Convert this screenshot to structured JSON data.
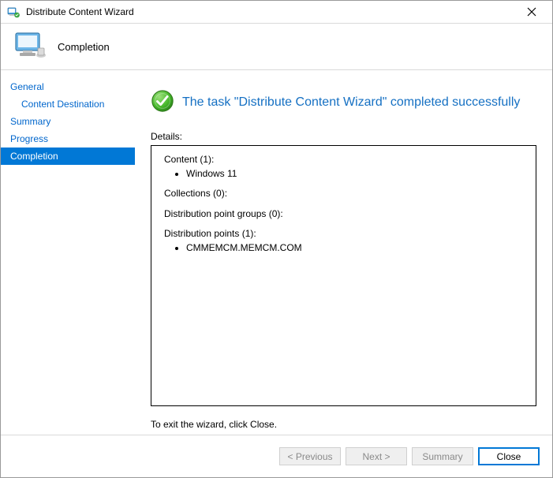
{
  "window": {
    "title": "Distribute Content Wizard"
  },
  "header": {
    "title": "Completion"
  },
  "sidebar": {
    "items": [
      {
        "label": "General"
      },
      {
        "label": "Content Destination"
      },
      {
        "label": "Summary"
      },
      {
        "label": "Progress"
      },
      {
        "label": "Completion"
      }
    ]
  },
  "main": {
    "successMessage": "The task \"Distribute Content Wizard\" completed successfully",
    "detailsLabel": "Details:",
    "content": {
      "heading": "Content (1):",
      "items": [
        "Windows 11"
      ]
    },
    "collections": {
      "heading": "Collections (0):"
    },
    "dpGroups": {
      "heading": "Distribution point groups (0):"
    },
    "dps": {
      "heading": "Distribution points (1):",
      "items": [
        "CMMEMCM.MEMCM.COM"
      ]
    },
    "exitLine": "To exit the wizard, click Close."
  },
  "footer": {
    "previous": "< Previous",
    "next": "Next >",
    "summary": "Summary",
    "close": "Close"
  }
}
